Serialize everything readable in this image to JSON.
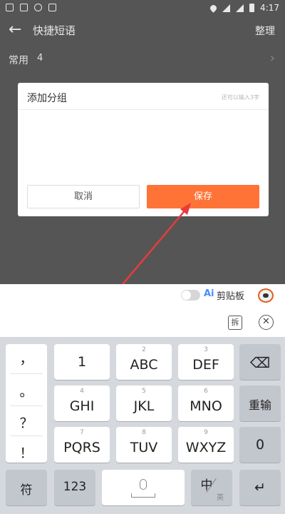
{
  "status_bar": {
    "time": "4:17"
  },
  "header": {
    "back_icon": "←",
    "title": "快捷短语",
    "action": "整理"
  },
  "list": {
    "row_label": "常用",
    "row_count": "4",
    "chevron": "›"
  },
  "dialog": {
    "title": "添加分组",
    "hint": "还可以输入3字",
    "input_value": "",
    "input_placeholder": "",
    "cancel_label": "取消",
    "save_label": "保存"
  },
  "toolbar": {
    "ai_label": "Ai",
    "clipboard_label": "剪贴板",
    "split_icon": "拆",
    "close_icon": "✕"
  },
  "keyboard": {
    "punctuation": [
      "，",
      "。",
      "？",
      "！"
    ],
    "keys": [
      {
        "sub": "",
        "main": "1"
      },
      {
        "sub": "2",
        "main": "ABC"
      },
      {
        "sub": "3",
        "main": "DEF"
      },
      {
        "sub": "4",
        "main": "GHI"
      },
      {
        "sub": "5",
        "main": "JKL"
      },
      {
        "sub": "6",
        "main": "MNO"
      },
      {
        "sub": "7",
        "main": "PQRS"
      },
      {
        "sub": "8",
        "main": "TUV"
      },
      {
        "sub": "9",
        "main": "WXYZ"
      }
    ],
    "backspace_icon": "⌫",
    "reinput_label": "重输",
    "zero_label": "0",
    "symbol_label": "符",
    "num_label": "123",
    "lang_main": "中",
    "lang_sub": "英",
    "enter_icon": "↵"
  },
  "colors": {
    "accent": "#ff7337",
    "arrow": "#e83b3b",
    "ai_blue": "#4a8cff"
  }
}
